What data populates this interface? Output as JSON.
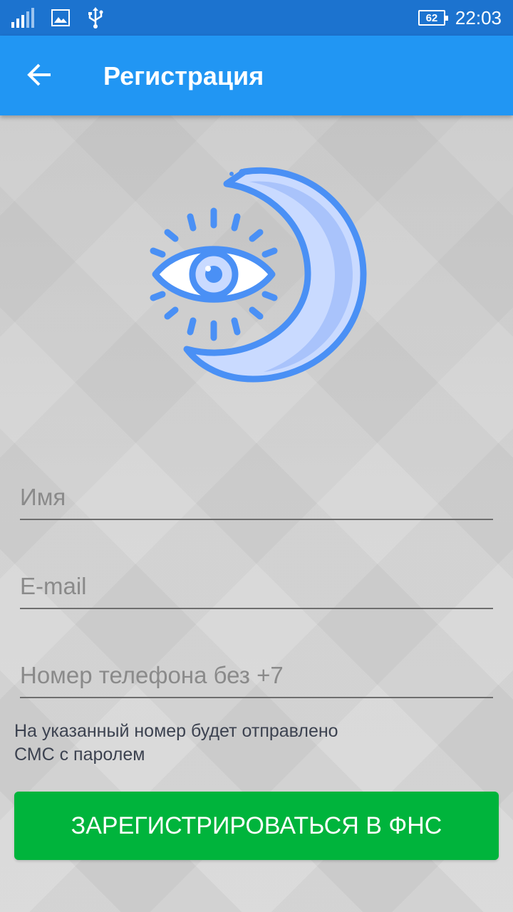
{
  "status_bar": {
    "time": "22:03",
    "battery": "62",
    "icons": [
      "signal-icon",
      "image-icon",
      "usb-icon"
    ]
  },
  "app_bar": {
    "title": "Регистрация",
    "back_icon": "arrow-back-icon"
  },
  "logo": {
    "icon": "eye-moon-logo-icon",
    "colors": {
      "stroke": "#4a90f5",
      "fill": "#c9daff"
    }
  },
  "form": {
    "name_placeholder": "Имя",
    "email_placeholder": "E-mail",
    "phone_placeholder": "Номер телефона без +7",
    "hint_line1": "На указанный номер будет отправлено",
    "hint_line2": "СМС с паролем",
    "submit_label": "ЗАРЕГИСТРИРОВАТЬСЯ В ФНС"
  },
  "colors": {
    "status_bar": "#1c73cf",
    "app_bar": "#2196f3",
    "button": "#00b43c"
  }
}
